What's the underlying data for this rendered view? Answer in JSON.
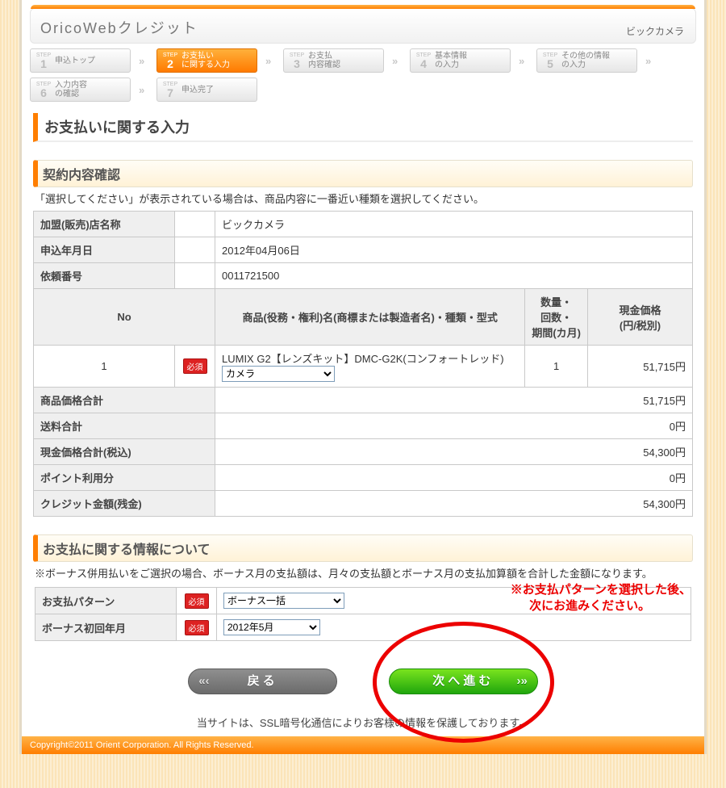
{
  "header": {
    "title": "OricoWebクレジット",
    "shop": "ビックカメラ"
  },
  "steps": {
    "r1": [
      {
        "n": "1",
        "label": "申込トップ",
        "active": false
      },
      {
        "n": "2",
        "label": "お支払い\nに関する入力",
        "active": true
      },
      {
        "n": "3",
        "label": "お支払\n内容確認",
        "active": false
      },
      {
        "n": "4",
        "label": "基本情報\nの入力",
        "active": false
      },
      {
        "n": "5",
        "label": "その他の情報\nの入力",
        "active": false
      }
    ],
    "r2": [
      {
        "n": "6",
        "label": "入力内容\nの確認",
        "active": false
      },
      {
        "n": "7",
        "label": "申込完了",
        "active": false
      }
    ]
  },
  "page_title": "お支払いに関する入力",
  "sec1": {
    "heading": "契約内容確認",
    "note": "「選択してください」が表示されている場合は、商品内容に一番近い種類を選択してください。",
    "rows": {
      "store_label": "加盟(販売)店名称",
      "store_value": "ビックカメラ",
      "date_label": "申込年月日",
      "date_value": "2012年04月06日",
      "reqno_label": "依頼番号",
      "reqno_value": "0011721500"
    },
    "cols": {
      "no": "No",
      "product": "商品(役務・権利)名(商標または製造者名)・種類・型式",
      "qty": "数量・\n回数・\n期間(カ月)",
      "price": "現金価格\n(円/税別)"
    },
    "item": {
      "no": "1",
      "required": "必須",
      "name": "LUMIX G2【レンズキット】DMC-G2K(コンフォートレッド)",
      "category_selected": "カメラ",
      "qty": "1",
      "price": "51,715円"
    },
    "totals": {
      "product_total_label": "商品価格合計",
      "product_total": "51,715円",
      "shipping_label": "送料合計",
      "shipping_value": "0円",
      "cash_total_label": "現金価格合計(税込)",
      "cash_total": "54,300円",
      "point_label": "ポイント利用分",
      "point_value": "0円",
      "credit_label": "クレジット金額(残金)",
      "credit_value": "54,300円"
    }
  },
  "sec2": {
    "heading": "お支払に関する情報について",
    "note": "※ボーナス併用払いをご選択の場合、ボーナス月の支払額は、月々の支払額とボーナス月の支払加算額を合計した金額になります。",
    "required": "必須",
    "pattern_label": "お支払パターン",
    "pattern_value": "ボーナス一括",
    "bonus_label": "ボーナス初回年月",
    "bonus_value": "2012年5月",
    "red_text": "※お支払パターンを選択した後、\n　  次にお進みください。"
  },
  "buttons": {
    "back": "戻る",
    "next": "次へ進む"
  },
  "footer_note": "当サイトは、SSL暗号化通信によりお客様の情報を保護しております。",
  "copyright": "Copyright©2011 Orient Corporation. All Rights Reserved."
}
